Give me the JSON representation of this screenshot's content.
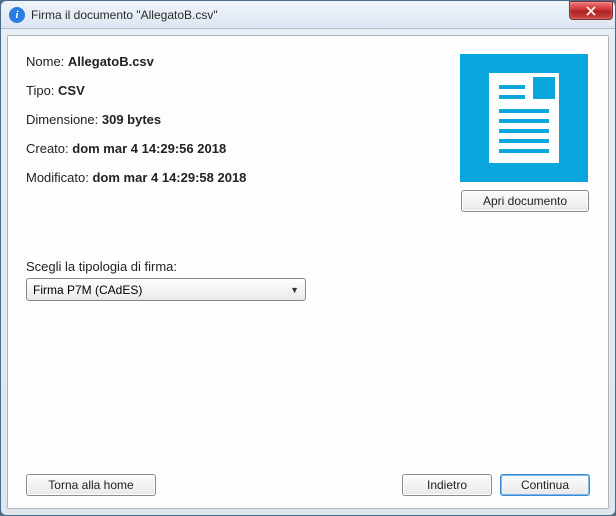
{
  "titlebar": {
    "icon_glyph": "i",
    "title": "Firma il documento \"AllegatoB.csv\"",
    "close_glyph": "✕"
  },
  "info": {
    "name_label": "Nome: ",
    "name_value": "AllegatoB.csv",
    "type_label": "Tipo: ",
    "type_value": "CSV",
    "size_label": "Dimensione: ",
    "size_value": "309 bytes",
    "created_label": "Creato: ",
    "created_value": "dom mar 4 14:29:56 2018",
    "modified_label": "Modificato: ",
    "modified_value": "dom mar 4 14:29:58 2018"
  },
  "open_button": "Apri documento",
  "signature": {
    "label": "Scegli la tipologia di firma:",
    "selected": "Firma P7M (CAdES)"
  },
  "footer": {
    "home": "Torna alla home",
    "back": "Indietro",
    "next": "Continua"
  }
}
